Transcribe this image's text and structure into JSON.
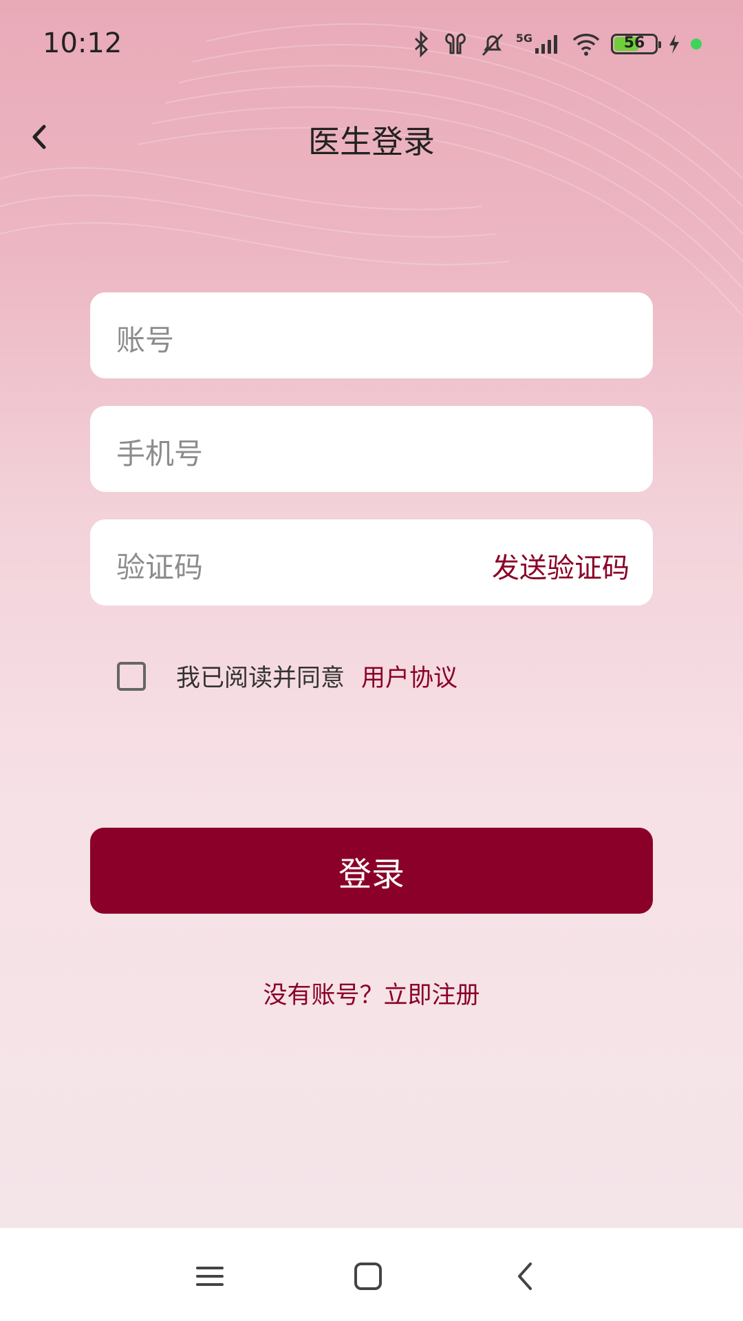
{
  "status_bar": {
    "time": "10:12",
    "network": "5G",
    "battery_level": "56",
    "battery_color": "#6fcf3b",
    "icons": [
      "bluetooth-icon",
      "earbuds-icon",
      "mute-icon",
      "signal-icon",
      "wifi-icon",
      "battery-icon",
      "charging-icon",
      "dot-indicator"
    ]
  },
  "header": {
    "title": "医生登录",
    "back_icon": "chevron-left-icon"
  },
  "form": {
    "account_placeholder": "账号",
    "phone_placeholder": "手机号",
    "code_placeholder": "验证码",
    "send_code_label": "发送验证码",
    "agree_text": "我已阅读并同意",
    "agreement_link": "用户协议",
    "agree_checked": false,
    "login_label": "登录",
    "register_link": "没有账号？立即注册"
  },
  "colors": {
    "accent": "#8b0029",
    "background_top": "#e9aab8",
    "background_bottom": "#f4e5e9"
  },
  "system_nav": {
    "icons": [
      "menu-icon",
      "home-icon",
      "back-icon"
    ]
  }
}
